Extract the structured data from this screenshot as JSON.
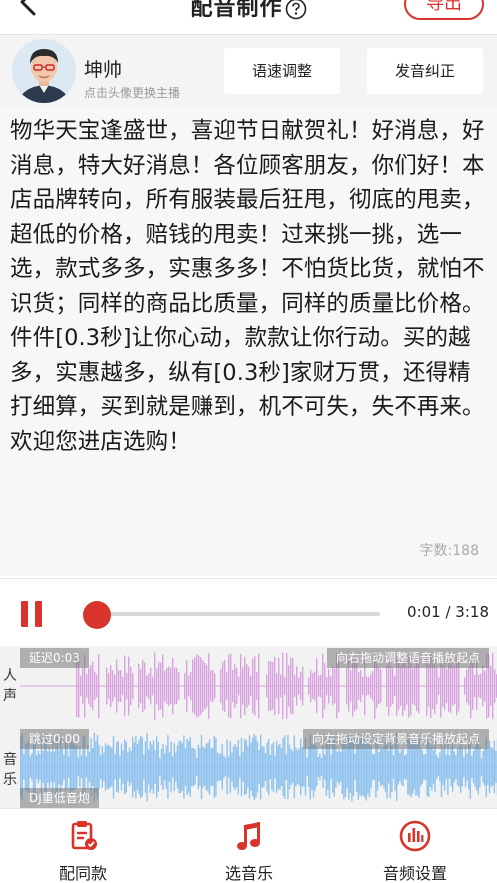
{
  "nav": {
    "title": "配音制作",
    "export_label": "导出"
  },
  "voice": {
    "anchor_name": "坤帅",
    "anchor_hint": "点击头像更换主播",
    "speed_button": "语速调整",
    "pronunciation_button": "发音纠正"
  },
  "script": {
    "text": "物华天宝逢盛世，喜迎节日献贺礼！好消息，好消息，特大好消息！各位顾客朋友，你们好！本店品牌转向，所有服装最后狂甩，彻底的甩卖，超低的价格，赔钱的甩卖！过来挑一挑，选一选，款式多多，实惠多多！不怕货比货，就怕不识货；同样的商品比质量，同样的质量比价格。件件[0.3秒]让你心动，款款让你行动。买的越多，实惠越多，纵有[0.3秒]家财万贯，还得精打细算，买到就是赚到，机不可失，失不再来。欢迎您进店选购！",
    "char_count": "字数:188"
  },
  "player": {
    "time": "0:01 / 3:18",
    "progress": 0.005
  },
  "vocal_track": {
    "label": "人声",
    "delay_tag": "延迟0:03",
    "hint_tag": "向右拖动调整语音播放起点",
    "color": "#d9a3e0"
  },
  "music_track": {
    "label": "音乐",
    "skip_tag": "跳过0:00",
    "hint_tag": "向左拖动设定背景音乐播放起点",
    "song_tag": "DJ重低音炮",
    "color": "#8fc3ee"
  },
  "tabs": [
    {
      "label": "配同款",
      "icon": "clipboard-icon"
    },
    {
      "label": "选音乐",
      "icon": "music-note-icon"
    },
    {
      "label": "音频设置",
      "icon": "audio-settings-icon"
    }
  ],
  "colors": {
    "accent": "#d9342b"
  }
}
